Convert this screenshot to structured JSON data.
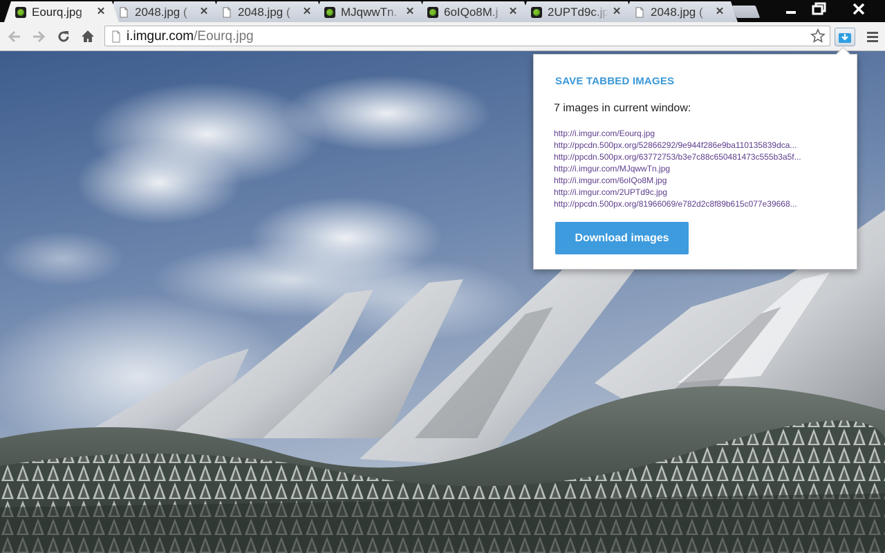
{
  "tabs": [
    {
      "title": "Eourq.jpg",
      "favicon": "imgur-icon",
      "active": true
    },
    {
      "title": "2048.jpg (",
      "favicon": "page-icon",
      "active": false
    },
    {
      "title": "2048.jpg (",
      "favicon": "page-icon",
      "active": false
    },
    {
      "title": "MJqwwTn.",
      "favicon": "imgur-icon",
      "active": false
    },
    {
      "title": "6oIQo8M.j",
      "favicon": "imgur-icon",
      "active": false
    },
    {
      "title": "2UPTd9c.jp",
      "favicon": "imgur-icon",
      "active": false
    },
    {
      "title": "2048.jpg (",
      "favicon": "page-icon",
      "active": false
    }
  ],
  "omnibox": {
    "host": "i.imgur.com",
    "path": "/Eourq.jpg"
  },
  "popup": {
    "heading": "SAVE TABBED IMAGES",
    "count_text": "7 images in current window:",
    "links": [
      "http://i.imgur.com/Eourq.jpg",
      "http://ppcdn.500px.org/52866292/9e944f286e9ba110135839dca...",
      "http://ppcdn.500px.org/63772753/b3e7c88c650481473c555b3a5f...",
      "http://i.imgur.com/MJqwwTn.jpg",
      "http://i.imgur.com/6oIQo8M.jpg",
      "http://i.imgur.com/2UPTd9c.jpg",
      "http://ppcdn.500px.org/81966069/e782d2c8f89b615c077e39668..."
    ],
    "button_label": "Download images"
  },
  "colors": {
    "accent": "#3d9bde",
    "heading": "#3a98d8",
    "link": "#5c3c8c"
  }
}
